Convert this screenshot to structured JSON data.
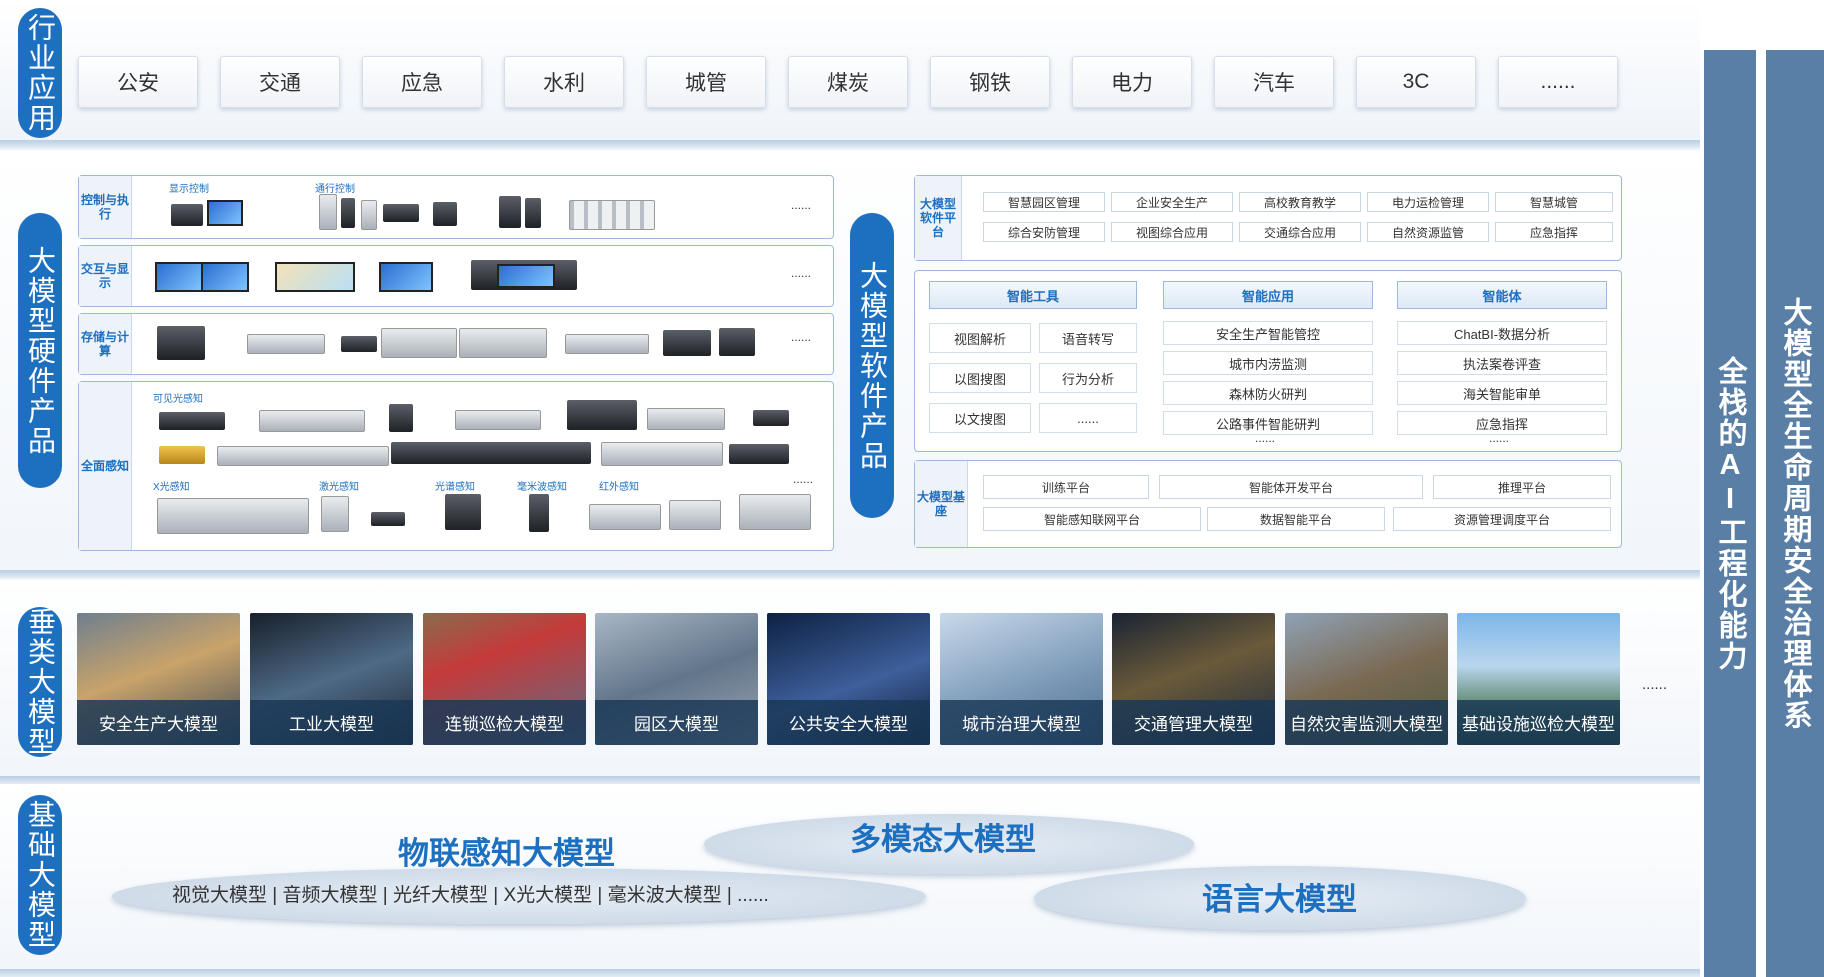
{
  "layers": {
    "industry": "行业应用",
    "hardware": "大模型硬件产品",
    "software": "大模型软件产品",
    "vertical": "垂类大模型",
    "foundation": "基础大模型"
  },
  "right_bars": [
    "全栈的AI工程化能力",
    "大模型全生命周期安全治理体系"
  ],
  "industries": [
    "公安",
    "交通",
    "应急",
    "水利",
    "城管",
    "煤炭",
    "钢铁",
    "电力",
    "汽车",
    "3C",
    "......"
  ],
  "hardware": {
    "rows": [
      {
        "label": "控制与执行",
        "subs": [
          "显示控制",
          "通行控制"
        ]
      },
      {
        "label": "交互与显示",
        "subs": []
      },
      {
        "label": "存储与计算",
        "subs": []
      },
      {
        "label": "全面感知",
        "subs": [
          "可见光感知",
          "X光感知",
          "激光感知",
          "光谱感知",
          "毫米波感知",
          "红外感知"
        ]
      }
    ],
    "more": "......"
  },
  "software": {
    "platform_label": "大模型软件平台",
    "platform_items": [
      "智慧园区管理",
      "企业安全生产",
      "高校教育教学",
      "电力运检管理",
      "智慧城管",
      "综合安防管理",
      "视图综合应用",
      "交通综合应用",
      "自然资源监管",
      "应急指挥"
    ],
    "tools_header": "智能工具",
    "tools": [
      "视图解析",
      "语音转写",
      "以图搜图",
      "行为分析",
      "以文搜图",
      "......"
    ],
    "apps_header": "智能应用",
    "apps": [
      "安全生产智能管控",
      "城市内涝监测",
      "森林防火研判",
      "公路事件智能研判",
      "......"
    ],
    "agents_header": "智能体",
    "agents": [
      "ChatBI-数据分析",
      "执法案卷评查",
      "海关智能审单",
      "应急指挥",
      "......"
    ],
    "base_label": "大模型基座",
    "base_items": [
      "训练平台",
      "智能体开发平台",
      "推理平台",
      "智能感知联网平台",
      "数据智能平台",
      "资源管理调度平台"
    ]
  },
  "vertical_models": [
    "安全生产大模型",
    "工业大模型",
    "连锁巡检大模型",
    "园区大模型",
    "公共安全大模型",
    "城市治理大模型",
    "交通管理大模型",
    "自然灾害监测大模型",
    "基础设施巡检大模型"
  ],
  "vertical_more": "......",
  "foundation": {
    "iot": "物联感知大模型",
    "iot_items": "视觉大模型 | 音频大模型 | 光纤大模型 | X光大模型 | 毫米波大模型 | ......",
    "multimodal": "多模态大模型",
    "language": "语言大模型"
  },
  "colors": {
    "accent": "#1d6fc0",
    "bar": "#5a7fa6"
  }
}
